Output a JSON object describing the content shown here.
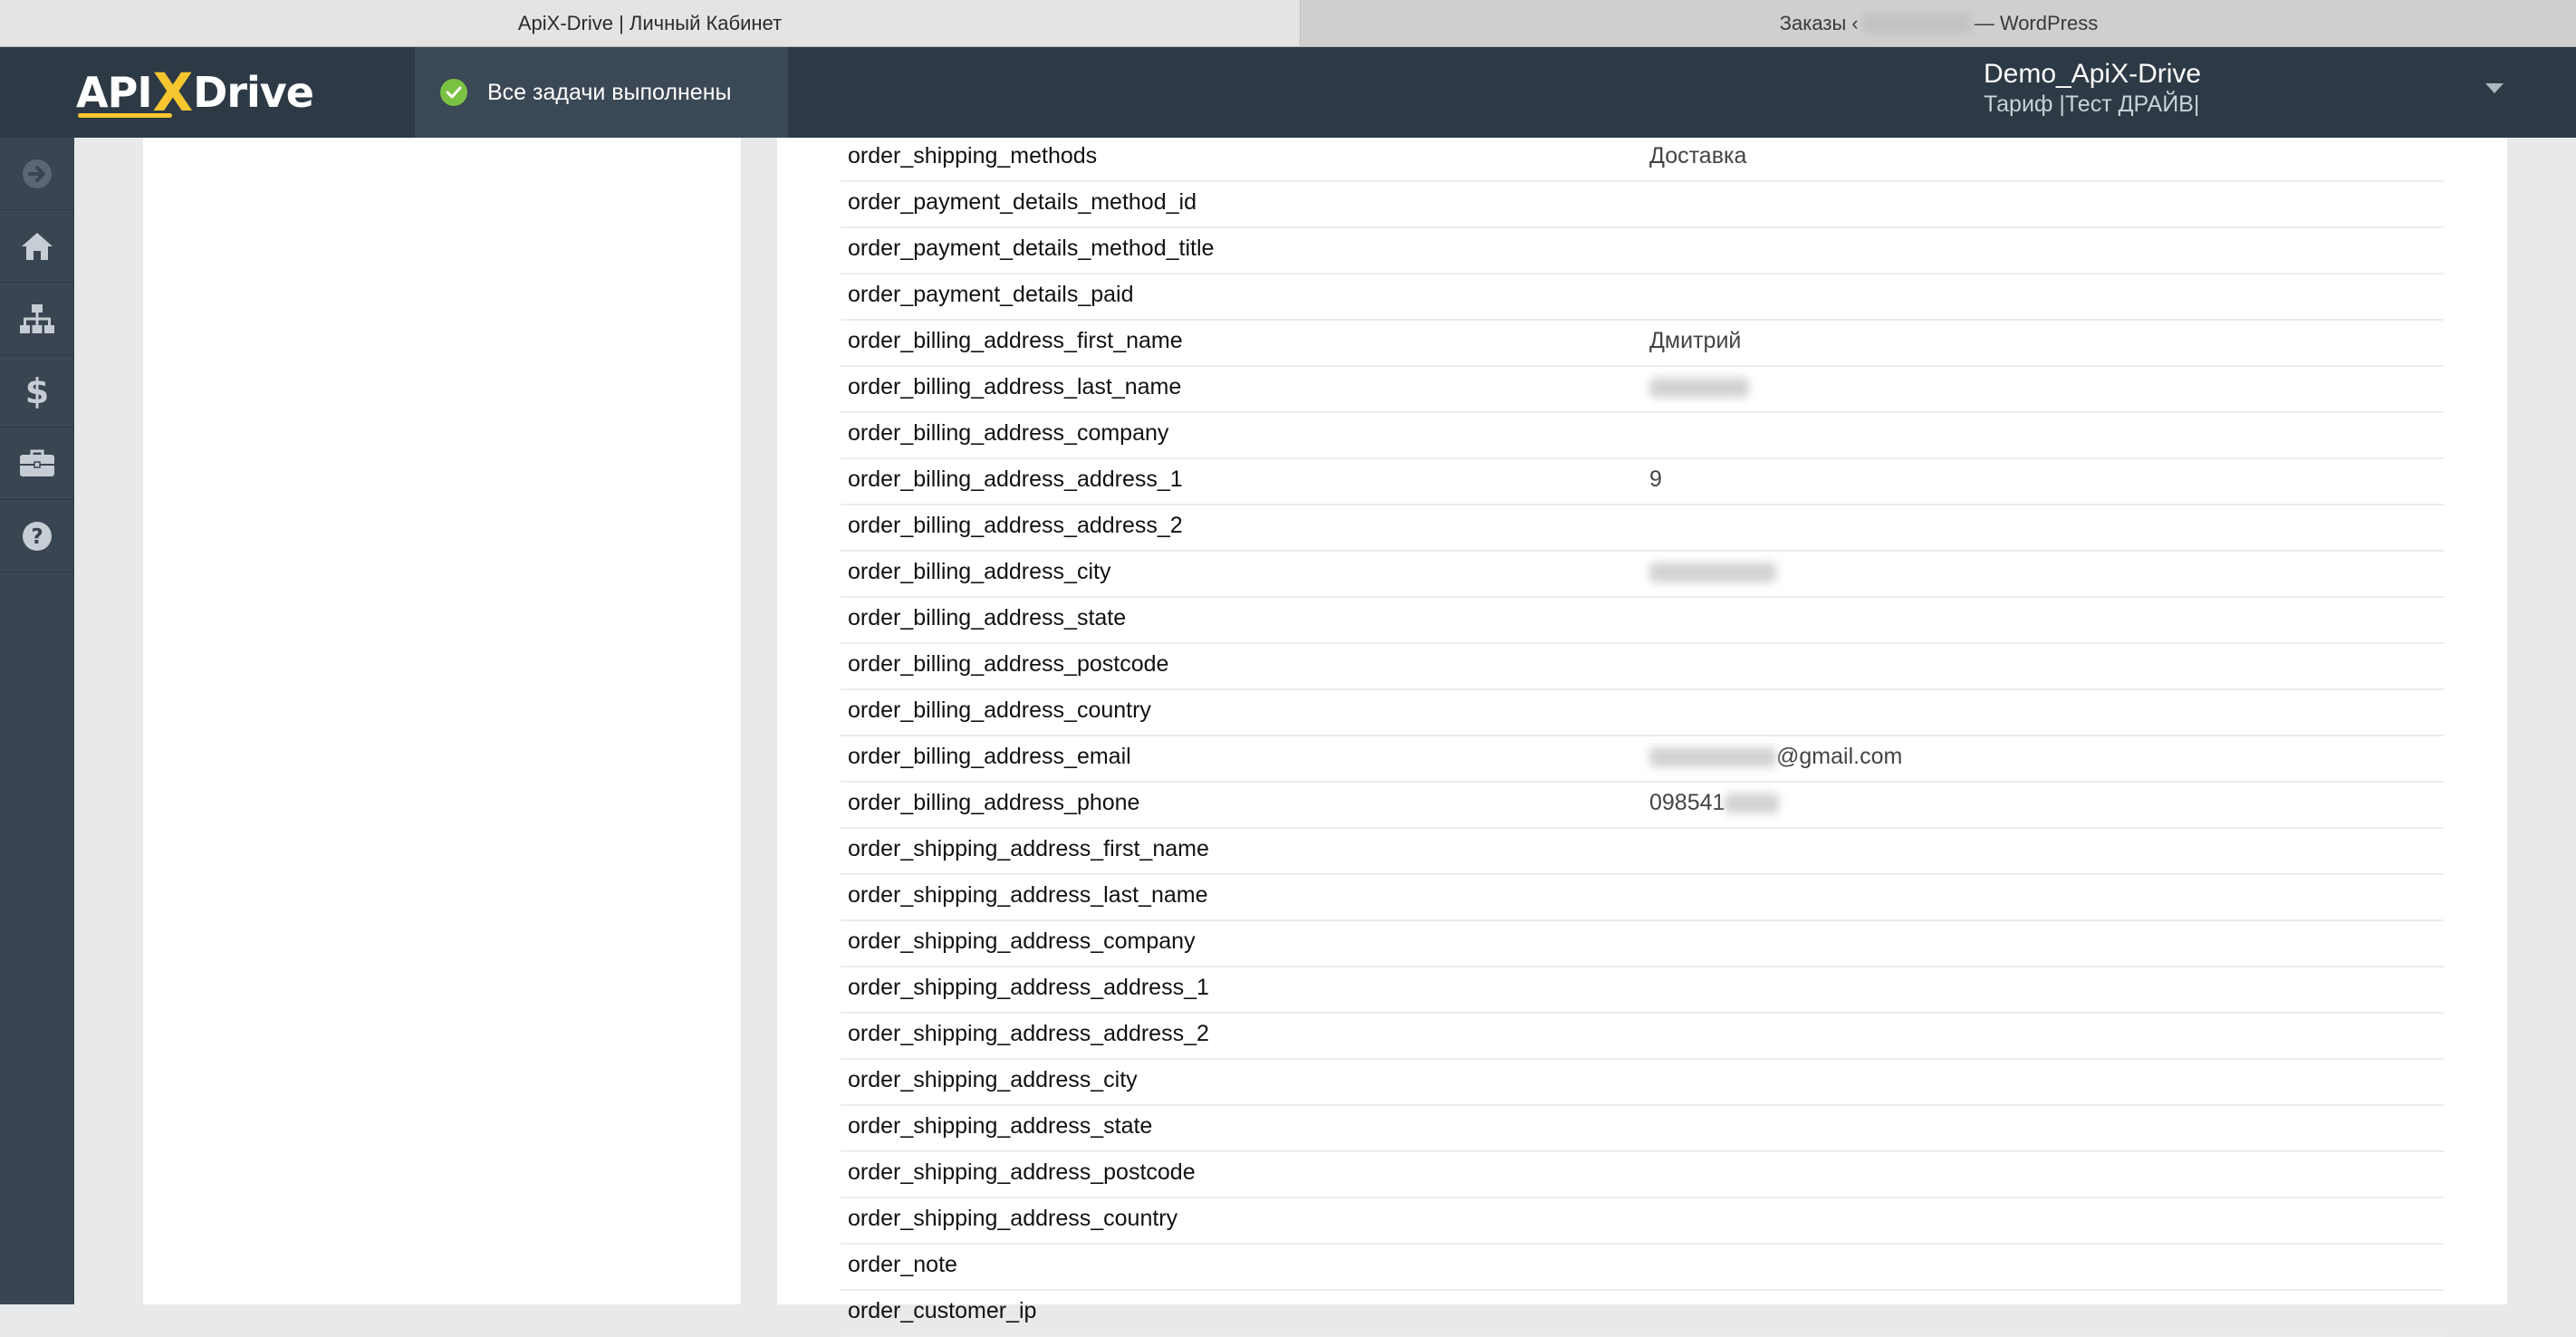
{
  "browser": {
    "tabs": [
      {
        "title": "ApiX-Drive | Личный Кабинет"
      },
      {
        "title_prefix": "Заказы ‹",
        "title_suffix": "— WordPress"
      }
    ]
  },
  "header": {
    "logo_left": "API",
    "logo_x": "X",
    "logo_right": "Drive",
    "status_text": "Все задачи выполнены",
    "user_name": "Demo_ApiX-Drive",
    "user_plan": "Тариф |Тест ДРАЙВ|"
  },
  "sidebar": {
    "icons": [
      "arrow-right-circle-icon",
      "home-icon",
      "sitemap-icon",
      "dollar-icon",
      "briefcase-icon",
      "help-circle-icon"
    ]
  },
  "fields": [
    {
      "key": "order_shipping_methods",
      "value": "Доставка"
    },
    {
      "key": "order_payment_details_method_id",
      "value": ""
    },
    {
      "key": "order_payment_details_method_title",
      "value": ""
    },
    {
      "key": "order_payment_details_paid",
      "value": ""
    },
    {
      "key": "order_billing_address_first_name",
      "value": "Дмитрий"
    },
    {
      "key": "order_billing_address_last_name",
      "value": ""
    },
    {
      "key": "order_billing_address_company",
      "value": ""
    },
    {
      "key": "order_billing_address_address_1",
      "value": "9"
    },
    {
      "key": "order_billing_address_address_2",
      "value": ""
    },
    {
      "key": "order_billing_address_city",
      "value": ""
    },
    {
      "key": "order_billing_address_state",
      "value": ""
    },
    {
      "key": "order_billing_address_postcode",
      "value": ""
    },
    {
      "key": "order_billing_address_country",
      "value": ""
    },
    {
      "key": "order_billing_address_email",
      "value": "@gmail.com"
    },
    {
      "key": "order_billing_address_phone",
      "value": "098541"
    },
    {
      "key": "order_shipping_address_first_name",
      "value": ""
    },
    {
      "key": "order_shipping_address_last_name",
      "value": ""
    },
    {
      "key": "order_shipping_address_company",
      "value": ""
    },
    {
      "key": "order_shipping_address_address_1",
      "value": ""
    },
    {
      "key": "order_shipping_address_address_2",
      "value": ""
    },
    {
      "key": "order_shipping_address_city",
      "value": ""
    },
    {
      "key": "order_shipping_address_state",
      "value": ""
    },
    {
      "key": "order_shipping_address_postcode",
      "value": ""
    },
    {
      "key": "order_shipping_address_country",
      "value": ""
    },
    {
      "key": "order_note",
      "value": ""
    },
    {
      "key": "order_customer_ip",
      "value": ""
    }
  ],
  "colors": {
    "header_bg": "#2d3a46",
    "sidebar_bg": "#3a4552",
    "logo_accent": "#f7c62f",
    "success": "#7bc143"
  }
}
